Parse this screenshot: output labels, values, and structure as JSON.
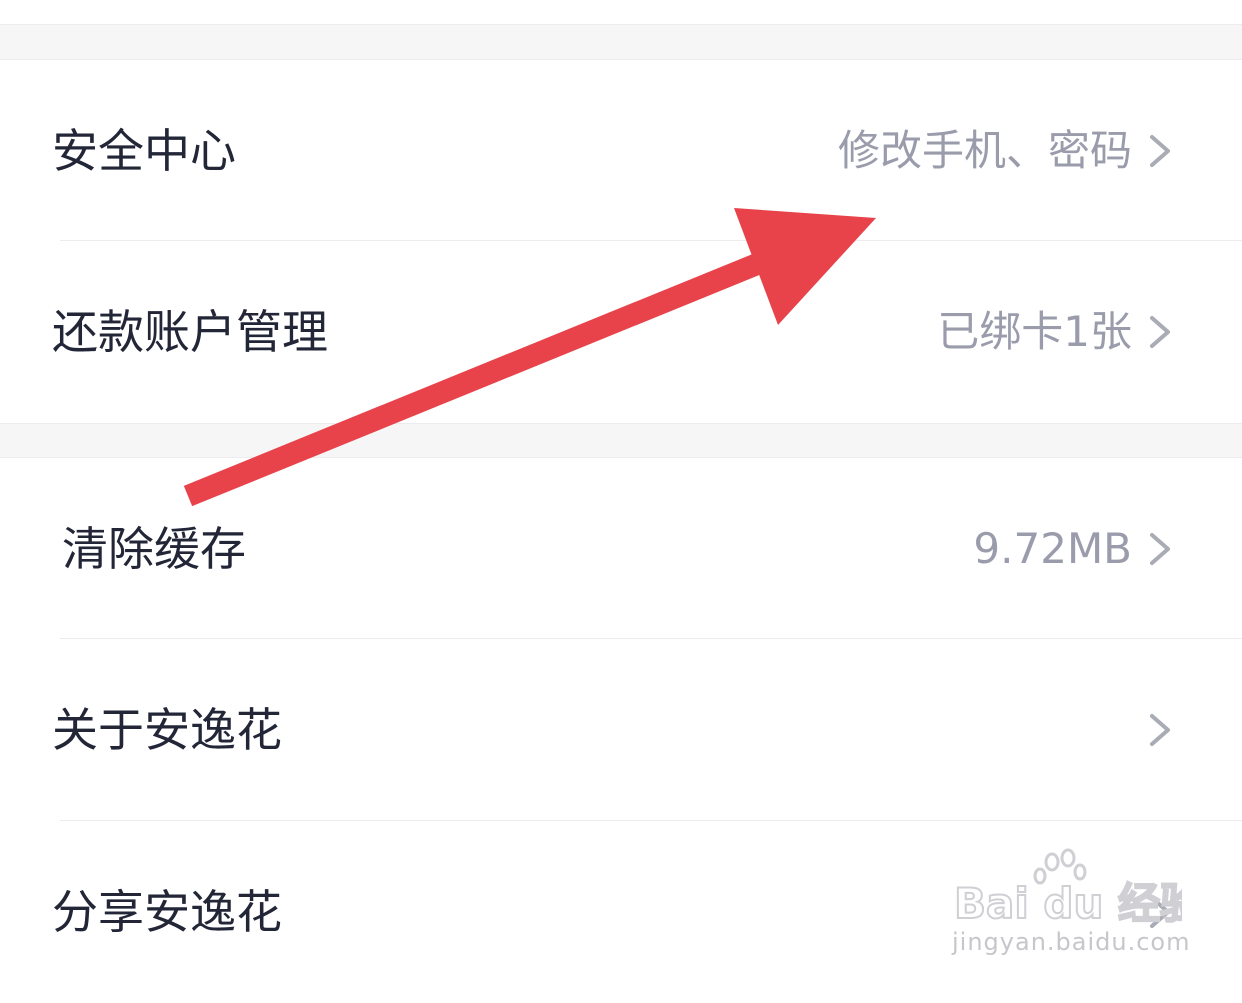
{
  "settings": {
    "items": [
      {
        "label": "安全中心",
        "value": "修改手机、密码"
      },
      {
        "label": "还款账户管理",
        "value": "已绑卡1张"
      },
      {
        "label": "清除缓存",
        "value": "9.72MB"
      },
      {
        "label": "关于安逸花",
        "value": ""
      },
      {
        "label": "分享安逸花",
        "value": ""
      }
    ]
  },
  "icons": {
    "row_chevron": "chevron-right-icon"
  },
  "annotation": {
    "arrow_color": "#e8434a"
  },
  "watermark": {
    "brand": "Bai du 经验",
    "url": "jingyan.baidu.com"
  },
  "colors": {
    "label": "#222637",
    "value": "#9a9cac",
    "section_gap": "#f6f6f7",
    "divider": "#ececee"
  }
}
